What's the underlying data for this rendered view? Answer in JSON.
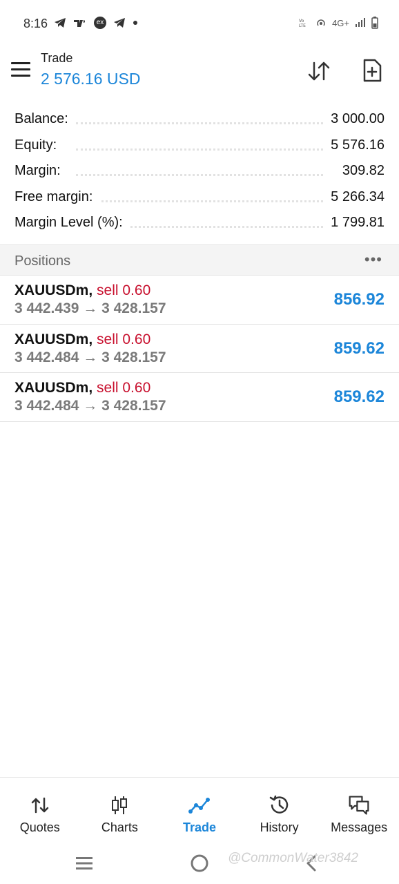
{
  "status_bar": {
    "time": "8:16",
    "left_icons": [
      "telegram-icon",
      "tradingview-icon",
      "exness-icon",
      "telegram-icon",
      "dot-icon"
    ],
    "network": "4G+",
    "right_icons": [
      "volte-icon",
      "hotspot-icon",
      "signal-icon",
      "battery-icon"
    ]
  },
  "header": {
    "label": "Trade",
    "value": "2 576.16 USD",
    "accent_color": "#1c86d9"
  },
  "summary": [
    {
      "label": "Balance:",
      "value": "3 000.00"
    },
    {
      "label": "Equity:",
      "value": "5 576.16"
    },
    {
      "label": "Margin:",
      "value": "309.82"
    },
    {
      "label": "Free margin:",
      "value": "5 266.34"
    },
    {
      "label": "Margin Level (%):",
      "value": "1 799.81"
    }
  ],
  "positions": {
    "title": "Positions",
    "more": "•••",
    "items": [
      {
        "symbol": "XAUUSDm,",
        "direction": "sell 0.60",
        "prices": "3 442.439 → 3 428.157",
        "profit": "856.92"
      },
      {
        "symbol": "XAUUSDm,",
        "direction": "sell 0.60",
        "prices": "3 442.484 → 3 428.157",
        "profit": "859.62"
      },
      {
        "symbol": "XAUUSDm,",
        "direction": "sell 0.60",
        "prices": "3 442.484 → 3 428.157",
        "profit": "859.62"
      }
    ]
  },
  "bottom_nav": [
    {
      "label": "Quotes",
      "icon": "quotes-icon"
    },
    {
      "label": "Charts",
      "icon": "charts-icon"
    },
    {
      "label": "Trade",
      "icon": "trade-icon",
      "active": true
    },
    {
      "label": "History",
      "icon": "history-icon"
    },
    {
      "label": "Messages",
      "icon": "messages-icon"
    }
  ],
  "watermark": "@CommonWater3842"
}
